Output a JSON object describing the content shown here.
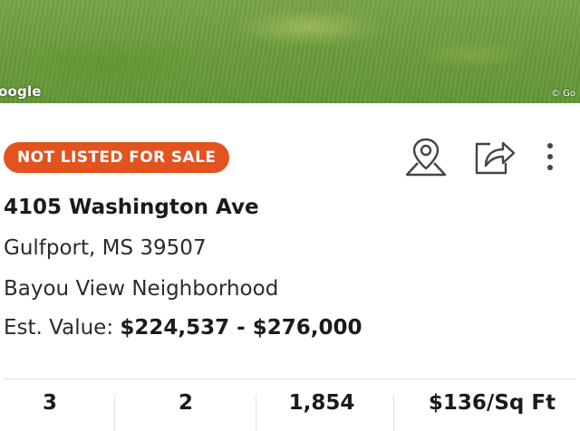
{
  "photo": {
    "credit_left": "oogle",
    "credit_right": "© Go"
  },
  "listing": {
    "badge": "NOT LISTED FOR SALE",
    "address": "4105 Washington Ave",
    "city_line": "Gulfport, MS 39507",
    "neighborhood": "Bayou View Neighborhood",
    "est_value_label": "Est. Value:",
    "est_value_range": "$224,537 - $276,000"
  },
  "actions": {
    "icons": [
      "map-pin-icon",
      "share-icon",
      "more-vertical-icon"
    ]
  },
  "stats": [
    "3",
    "2",
    "1,854",
    "$136/Sq Ft"
  ],
  "colors": {
    "badge_bg": "#e2531f",
    "text": "#1b1b1b",
    "icon": "#444444"
  }
}
